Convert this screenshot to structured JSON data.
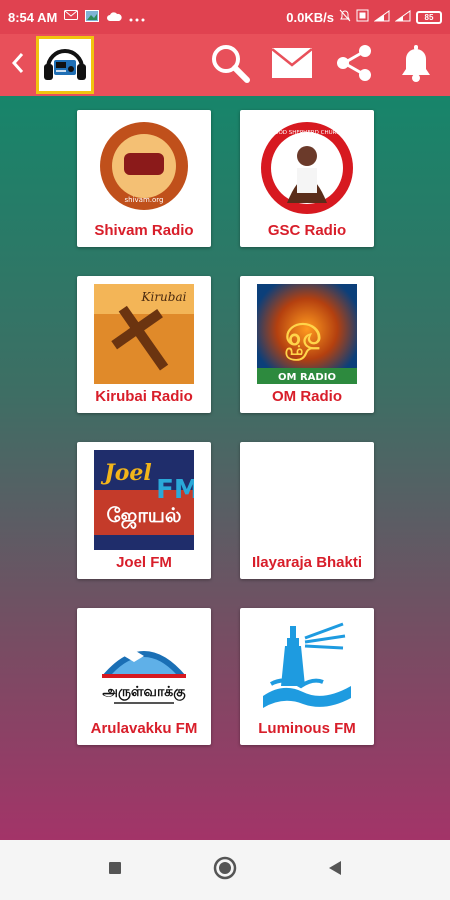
{
  "status_bar": {
    "time": "8:54 AM",
    "network_speed": "0.0KB/s",
    "battery": "85"
  },
  "app_bar": {
    "icons": [
      "chevron-left-icon",
      "radio-headphones-logo",
      "search-icon",
      "mail-icon",
      "share-icon",
      "bell-icon"
    ]
  },
  "stations": [
    {
      "name": "Shivam Radio",
      "logo_text": "shivam.org"
    },
    {
      "name": "GSC Radio",
      "logo_text": "GOOD SHEPHERD CHURCH"
    },
    {
      "name": "Kirubai Radio",
      "logo_text": "Kirubai"
    },
    {
      "name": "OM Radio",
      "logo_text": "OM RADIO"
    },
    {
      "name": "Joel FM",
      "logo_text": "Joel",
      "logo_text_2": "ஜோயல்",
      "logo_text_3": "FM"
    },
    {
      "name": "Ilayaraja Bhakti"
    },
    {
      "name": "Arulavakku FM",
      "logo_text": "அருள்வாக்கு"
    },
    {
      "name": "Luminous FM"
    }
  ],
  "colors": {
    "status_bar": "#e04250",
    "app_bar": "#e8505a",
    "label": "#d81e2a",
    "gradient_top": "#17856a",
    "gradient_bottom": "#a33468"
  }
}
